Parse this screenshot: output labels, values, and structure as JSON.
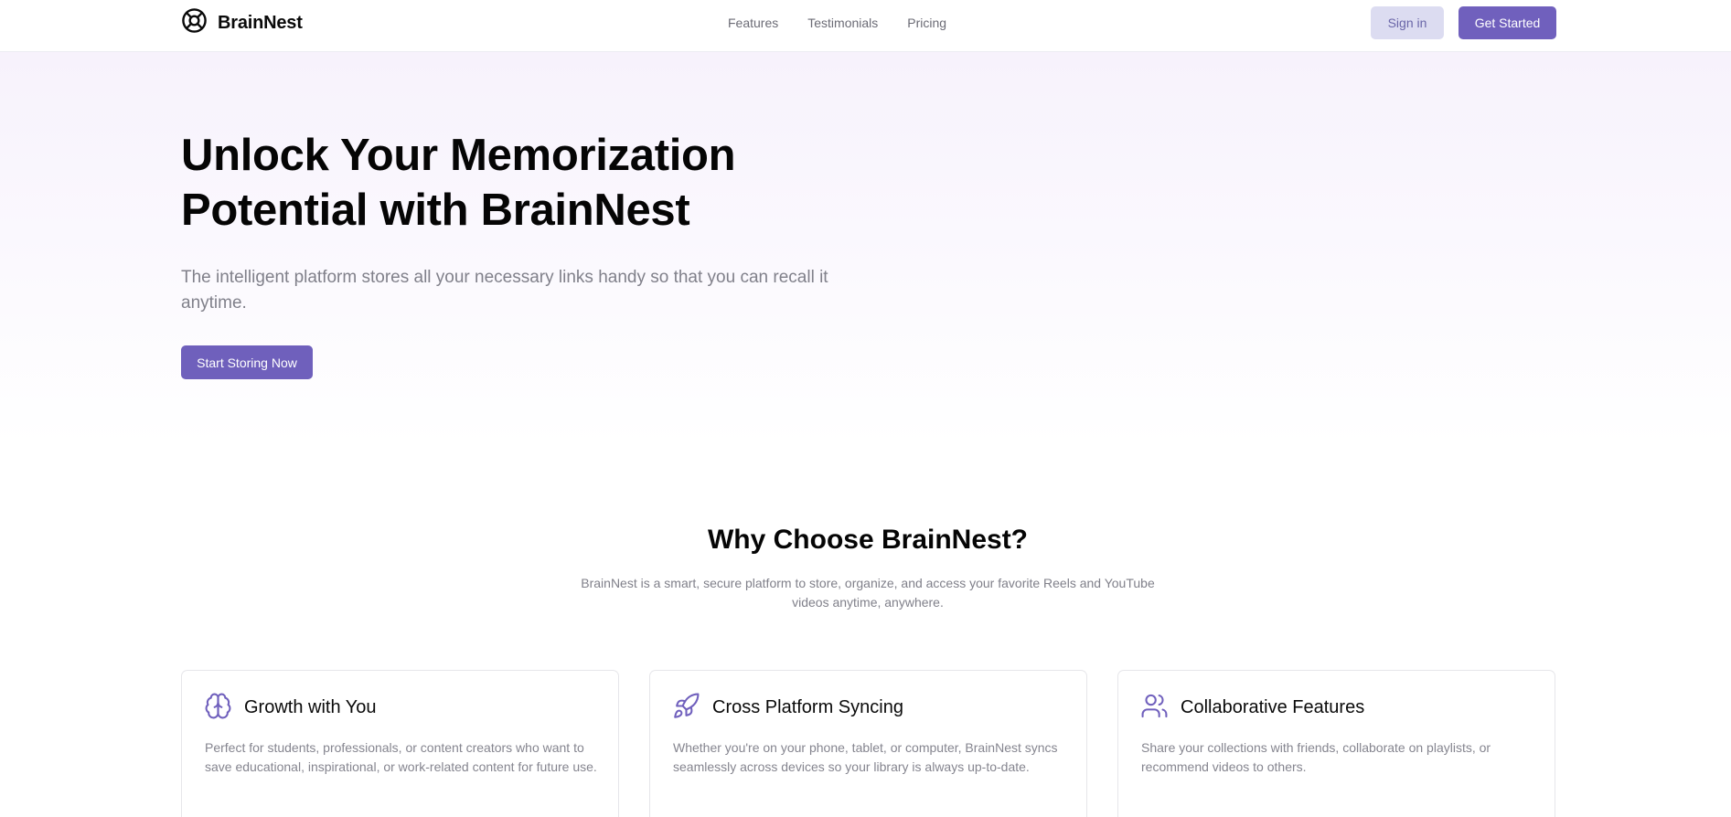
{
  "header": {
    "brand_name": "BrainNest",
    "logo_icon": "life-buoy-icon",
    "nav": [
      "Features",
      "Testimonials",
      "Pricing"
    ],
    "sign_in_label": "Sign in",
    "get_started_label": "Get Started"
  },
  "hero": {
    "title_line1": "Unlock Your Memorization",
    "title_line2": "Potential with BrainNest",
    "subtitle": "The intelligent platform stores all your necessary links handy so that you can recall it anytime.",
    "cta_label": "Start Storing Now"
  },
  "why": {
    "title": "Why Choose BrainNest?",
    "subtitle": "BrainNest is a smart, secure platform to store, organize, and access your favorite Reels and YouTube videos anytime, anywhere."
  },
  "features": [
    {
      "icon": "brain-icon",
      "title": "Growth with You",
      "desc": "Perfect for students, professionals, or content creators who want to save educational, inspirational, or work-related content for future use."
    },
    {
      "icon": "rocket-icon",
      "title": "Cross Platform Syncing",
      "desc": "Whether you're on your phone, tablet, or computer, BrainNest syncs seamlessly across devices so your library is always up-to-date."
    },
    {
      "icon": "users-icon",
      "title": "Collaborative Features",
      "desc": "Share your collections with friends, collaborate on playlists, or recommend videos to others."
    }
  ],
  "colors": {
    "accent": "#7060bd",
    "accent_soft": "#dcdcf1",
    "hero_bg": "#f7f2fc",
    "muted_text": "#80808a"
  }
}
